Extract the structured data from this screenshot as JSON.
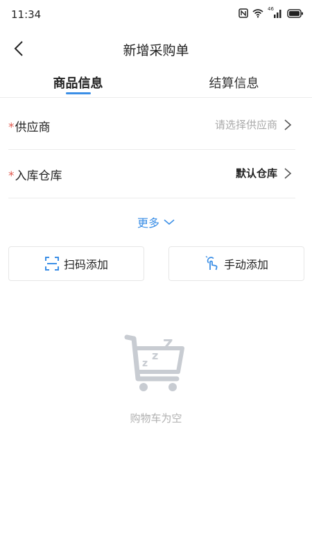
{
  "status_bar": {
    "time": "11:34",
    "icons": [
      "nfc-icon",
      "wifi-icon",
      "signal-icon",
      "battery-icon"
    ],
    "signal_label": "46"
  },
  "nav": {
    "title": "新增采购单",
    "back_icon": "chevron-left-icon"
  },
  "tabs": [
    {
      "label": "商品信息",
      "active": true
    },
    {
      "label": "结算信息",
      "active": false
    }
  ],
  "form": {
    "required_mark": "*",
    "supplier": {
      "label": "供应商",
      "placeholder": "请选择供应商"
    },
    "warehouse": {
      "label": "入库仓库",
      "value": "默认仓库"
    }
  },
  "more": {
    "label": "更多"
  },
  "actions": {
    "scan_label": "扫码添加",
    "manual_label": "手动添加"
  },
  "empty": {
    "text": "购物车为空",
    "icon": "sleeping-cart-icon"
  },
  "colors": {
    "accent": "#3a8ee6",
    "required": "#e05a4f",
    "placeholder": "#aaaaaa",
    "empty_icon": "#c8ccd2"
  }
}
